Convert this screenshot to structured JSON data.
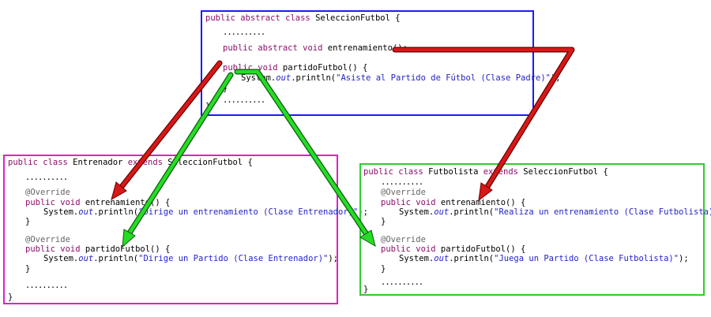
{
  "parent": {
    "line1_kw": "public abstract class",
    "line1_rest": " SeleccionFutbol {",
    "dots1": "..........",
    "line2_kw": "public abstract void",
    "line2_rest": " entrenamiento();",
    "line3_kw": "public void",
    "line3_rest": " partidoFutbol() {",
    "line4_pre": "System.",
    "line4_out": "out",
    "line4_mid": ".println(",
    "line4_str": "\"Asiste al Partido de Fútbol (Clase Padre)\"",
    "line4_end": ");",
    "close_inner": "}",
    "dots2": "..........",
    "close": "}"
  },
  "entrenador": {
    "line1_kw": "public class",
    "line1_mid": " Entrenador ",
    "line1_kw2": "extends",
    "line1_rest": " SeleccionFutbol {",
    "dots1": "..........",
    "ann1": "@Override",
    "m1_kw": "public void",
    "m1_rest": " entrenamiento() {",
    "m1_pre": "System.",
    "m1_out": "out",
    "m1_mid": ".println(",
    "m1_str": "\"Dirige un entrenamiento (Clase Entrenador)\"",
    "m1_end": ");",
    "m1_close": "}",
    "ann2": "@Override",
    "m2_kw": "public void",
    "m2_rest": " partidoFutbol() {",
    "m2_pre": "System.",
    "m2_out": "out",
    "m2_mid": ".println(",
    "m2_str": "\"Dirige un Partido (Clase Entrenador)\"",
    "m2_end": ");",
    "m2_close": "}",
    "dots2": "..........",
    "close": "}"
  },
  "futbolista": {
    "line1_kw": "public class",
    "line1_mid": " Futbolista ",
    "line1_kw2": "extends",
    "line1_rest": " SeleccionFutbol {",
    "dots1": "..........",
    "ann1": "@Override",
    "m1_kw": "public void",
    "m1_rest": " entrenamiento() {",
    "m1_pre": "System.",
    "m1_out": "out",
    "m1_mid": ".println(",
    "m1_str": "\"Realiza un entrenamiento (Clase Futbolista)\"",
    "m1_end": ");",
    "m1_close": "}",
    "ann2": "@Override",
    "m2_kw": "public void",
    "m2_rest": " partidoFutbol() {",
    "m2_pre": "System.",
    "m2_out": "out",
    "m2_mid": ".println(",
    "m2_str": "\"Juega un Partido (Clase Futbolista)\"",
    "m2_end": ");",
    "m2_close": "}",
    "dots2": "..........",
    "close": "}"
  },
  "colors": {
    "parent_border": "#1a1aff",
    "entrenador_border": "#e020c8",
    "futbolista_border": "#2fcc2f",
    "abstract_arrow": "#cc1111",
    "override_arrow": "#22dd22",
    "keyword": "#8b0f68",
    "string": "#2323c8"
  }
}
